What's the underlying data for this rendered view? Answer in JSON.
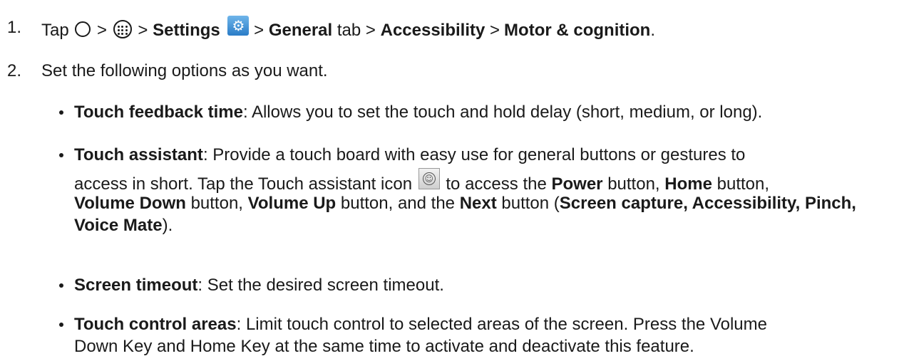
{
  "steps": [
    {
      "number": "1.",
      "tap": "Tap",
      "sep1": ">",
      "sep2": ">",
      "settings": "Settings",
      "sep3": ">",
      "general": "General",
      "tab": "tab",
      "sep4": ">",
      "accessibility": "Accessibility",
      "sep5": ">",
      "motor": "Motor & cognition",
      "period": "."
    },
    {
      "number": "2.",
      "text": "Set the following options as you want."
    }
  ],
  "options": {
    "touch_feedback": {
      "title": "Touch feedback time",
      "desc": ": Allows you to set the touch and hold delay (short, medium, or long)."
    },
    "touch_assistant": {
      "title": "Touch assistant",
      "desc1": ": Provide a touch board with easy use for general buttons or gestures to",
      "desc2a": "access in short. Tap the Touch assistant icon",
      "desc2b": "to access the",
      "power": "Power",
      "desc2c": "button,",
      "home": "Home",
      "desc2d": "button,",
      "vol_down": "Volume Down",
      "desc3a": "button,",
      "vol_up": "Volume Up",
      "desc3b": "button, and the",
      "next": "Next",
      "desc3c": "button (",
      "next_items": "Screen capture, Accessibility, Pinch, Voice Mate",
      "desc4": ")."
    },
    "screen_timeout": {
      "title": "Screen timeout",
      "desc": ": Set the desired screen timeout."
    },
    "touch_control": {
      "title": "Touch control areas",
      "desc1": ": Limit touch control to selected areas of the screen. Press the Volume",
      "desc2": "Down Key and Home Key at the same time to activate and deactivate this feature."
    }
  },
  "icons": {
    "home": "home-circle-icon",
    "apps": "apps-icon",
    "settings": "settings-gear-icon",
    "touch_assistant": "touch-assistant-icon"
  },
  "colors": {
    "text": "#1a1a1a",
    "settings_icon": "#2a7cc7"
  }
}
